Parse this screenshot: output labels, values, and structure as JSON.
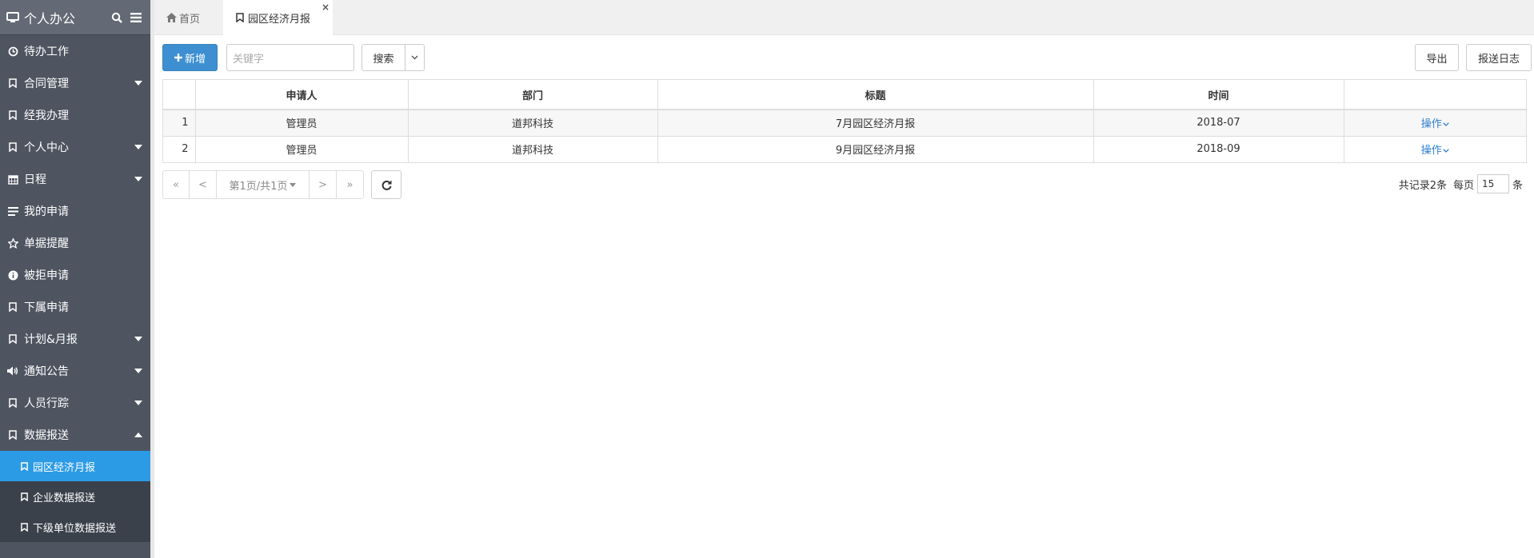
{
  "sidebar": {
    "title": "个人办公",
    "items": [
      {
        "label": "待办工作",
        "icon": "clock-icon",
        "caret": "none"
      },
      {
        "label": "合同管理",
        "icon": "bookmark-icon",
        "caret": "down"
      },
      {
        "label": "经我办理",
        "icon": "bookmark-icon",
        "caret": "none"
      },
      {
        "label": "个人中心",
        "icon": "bookmark-icon",
        "caret": "down"
      },
      {
        "label": "日程",
        "icon": "calendar-icon",
        "caret": "down"
      },
      {
        "label": "我的申请",
        "icon": "list-icon",
        "caret": "none"
      },
      {
        "label": "单据提醒",
        "icon": "star-icon",
        "caret": "none"
      },
      {
        "label": "被拒申请",
        "icon": "info-icon",
        "caret": "none"
      },
      {
        "label": "下属申请",
        "icon": "bookmark-icon",
        "caret": "none"
      },
      {
        "label": "计划&月报",
        "icon": "bookmark-icon",
        "caret": "down"
      },
      {
        "label": "通知公告",
        "icon": "volume-icon",
        "caret": "down"
      },
      {
        "label": "人员行踪",
        "icon": "bookmark-icon",
        "caret": "down"
      },
      {
        "label": "数据报送",
        "icon": "bookmark-icon",
        "caret": "up"
      }
    ],
    "subitems": [
      {
        "label": "园区经济月报",
        "active": true
      },
      {
        "label": "企业数据报送",
        "active": false
      },
      {
        "label": "下级单位数据报送",
        "active": false
      }
    ]
  },
  "tabs": {
    "home": "首页",
    "active": "园区经济月报",
    "close": "×"
  },
  "toolbar": {
    "add_label": "新增",
    "search_placeholder": "关键字",
    "search_label": "搜索",
    "export_label": "导出",
    "log_label": "报送日志"
  },
  "table": {
    "headers": [
      "",
      "申请人",
      "部门",
      "标题",
      "时间",
      ""
    ],
    "rows": [
      {
        "num": "1",
        "applicant": "管理员",
        "dept": "道邦科技",
        "title": "7月园区经济月报",
        "time": "2018-07",
        "op": "操作"
      },
      {
        "num": "2",
        "applicant": "管理员",
        "dept": "道邦科技",
        "title": "9月园区经济月报",
        "time": "2018-09",
        "op": "操作"
      }
    ]
  },
  "pager": {
    "first": "«",
    "prev": "<",
    "page": "第1页/共1页",
    "next": ">",
    "last": "»",
    "total": "共记录2条",
    "per_page_label": "每页",
    "per_page": "15",
    "unit": "条"
  },
  "colors": {
    "sidebar_bg": "#4e5561",
    "active_sub": "#2c9be6",
    "primary": "#3d8fd1",
    "link": "#2c7fd0"
  }
}
